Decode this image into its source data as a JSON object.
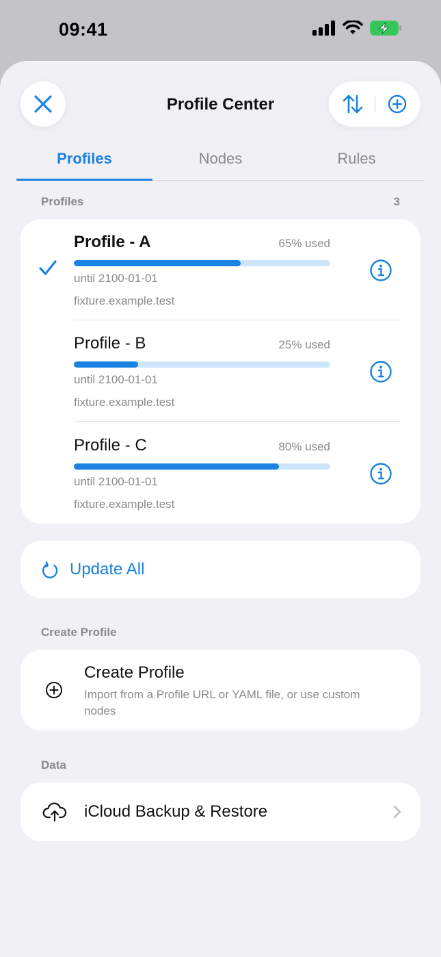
{
  "status_bar": {
    "time": "09:41"
  },
  "header": {
    "title": "Profile Center"
  },
  "tabs": [
    {
      "label": "Profiles",
      "active": true
    },
    {
      "label": "Nodes",
      "active": false
    },
    {
      "label": "Rules",
      "active": false
    }
  ],
  "profiles_section": {
    "label": "Profiles",
    "count": "3",
    "items": [
      {
        "name": "Profile - A",
        "used_text": "65% used",
        "used_fraction": 0.65,
        "until": "until 2100-01-01",
        "host": "fixture.example.test",
        "selected": true
      },
      {
        "name": "Profile - B",
        "used_text": "25% used",
        "used_fraction": 0.25,
        "until": "until 2100-01-01",
        "host": "fixture.example.test",
        "selected": false
      },
      {
        "name": "Profile - C",
        "used_text": "80% used",
        "used_fraction": 0.8,
        "until": "until 2100-01-01",
        "host": "fixture.example.test",
        "selected": false
      }
    ]
  },
  "update_all": {
    "label": "Update All"
  },
  "create_section": {
    "label": "Create Profile",
    "title": "Create Profile",
    "subtitle": "Import from a Profile URL or YAML file, or use custom nodes"
  },
  "data_section": {
    "label": "Data",
    "backup_label": "iCloud Backup & Restore"
  },
  "colors": {
    "accent": "#1a82e0",
    "track": "#cde6fb",
    "battery": "#34c759"
  }
}
